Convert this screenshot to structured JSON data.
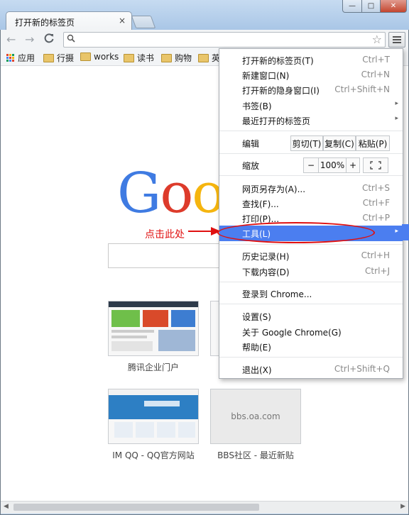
{
  "window": {
    "tab_title": "打开新的标签页",
    "tab_close": "×",
    "buttons": {
      "minimize": "—",
      "maximize": "□",
      "close": "✕"
    }
  },
  "toolbar": {
    "back_icon": "←",
    "forward_icon": "→",
    "reload_icon": "C",
    "omnibox_value": "",
    "search_icon": "🔍",
    "star_icon": "☆"
  },
  "bookmarks": {
    "items": [
      {
        "label": "应用",
        "icon": "apps-grid-icon"
      },
      {
        "label": "行摄",
        "icon": "folder-icon"
      },
      {
        "label": "works",
        "icon": "folder-icon"
      },
      {
        "label": "读书",
        "icon": "folder-icon"
      },
      {
        "label": "购物",
        "icon": "folder-icon"
      },
      {
        "label": "英",
        "icon": "folder-icon"
      }
    ]
  },
  "content": {
    "google_letters": [
      "G",
      "o",
      "o"
    ],
    "google_colors": [
      "#3f7be2",
      "#dd3b2b",
      "#f5b50f"
    ],
    "annotation": "点击此处",
    "thumbnails": [
      {
        "label": "腾讯企业门户"
      },
      {
        "label": "IM QQ - QQ官方网站"
      },
      {
        "label": "BBS社区 - 最近新贴",
        "thumb_text": "bbs.oa.com"
      }
    ]
  },
  "menu": {
    "items": [
      {
        "label": "打开新的标签页(T)",
        "shortcut": "Ctrl+T"
      },
      {
        "label": "新建窗口(N)",
        "shortcut": "Ctrl+N"
      },
      {
        "label": "打开新的隐身窗口(I)",
        "shortcut": "Ctrl+Shift+N"
      },
      {
        "label": "书签(B)",
        "submenu": "▸"
      },
      {
        "label": "最近打开的标签页",
        "submenu": "▸"
      }
    ],
    "edit": {
      "label": "编辑",
      "cut": "剪切(T)",
      "copy": "复制(C)",
      "paste": "粘贴(P)"
    },
    "zoom": {
      "label": "缩放",
      "minus": "−",
      "value": "100%",
      "plus": "+",
      "fullscreen": "⛶"
    },
    "page_items": [
      {
        "label": "网页另存为(A)...",
        "shortcut": "Ctrl+S"
      },
      {
        "label": "查找(F)...",
        "shortcut": "Ctrl+F"
      },
      {
        "label": "打印(P)...",
        "shortcut": "Ctrl+P"
      }
    ],
    "tools": {
      "label": "工具(L)",
      "submenu": "▸"
    },
    "history": {
      "label": "历史记录(H)",
      "shortcut": "Ctrl+H"
    },
    "downloads": {
      "label": "下载内容(D)",
      "shortcut": "Ctrl+J"
    },
    "signin": {
      "label": "登录到 Chrome..."
    },
    "settings": {
      "label": "设置(S)"
    },
    "about": {
      "label": "关于 Google Chrome(G)"
    },
    "help": {
      "label": "帮助(E)"
    },
    "exit": {
      "label": "退出(X)",
      "shortcut": "Ctrl+Shift+Q"
    }
  },
  "colors": {
    "accent": "#4b7ef0",
    "annotation": "#e01010"
  }
}
